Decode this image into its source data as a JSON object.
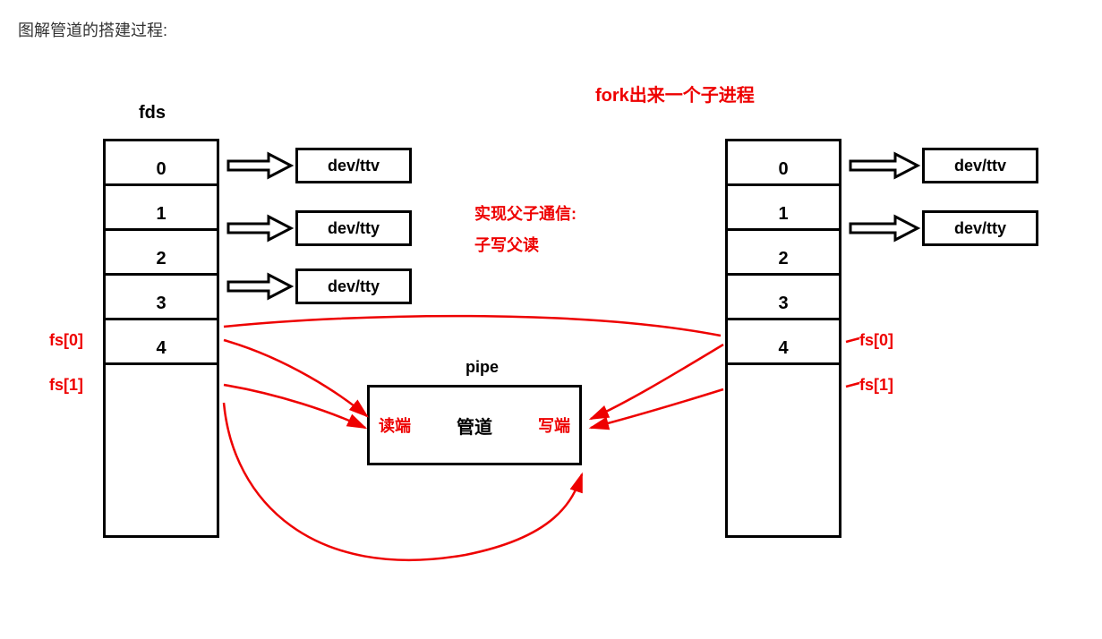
{
  "title": "图解管道的搭建过程:",
  "left": {
    "header": "fds",
    "cells": [
      "0",
      "1",
      "2",
      "3",
      "4"
    ],
    "fs0": "fs[0]",
    "fs1": "fs[1]",
    "devs": [
      "dev/ttv",
      "dev/tty",
      "dev/tty"
    ]
  },
  "right": {
    "header": "fork出来一个子进程",
    "cells": [
      "0",
      "1",
      "2",
      "3",
      "4"
    ],
    "fs0": "fs[0]",
    "fs1": "fs[1]",
    "devs": [
      "dev/ttv",
      "dev/tty"
    ]
  },
  "center": {
    "comm1": "实现父子通信:",
    "comm2": "子写父读",
    "pipe_label": "pipe",
    "pipe_text": "管道",
    "read_end": "读端",
    "write_end": "写端"
  }
}
